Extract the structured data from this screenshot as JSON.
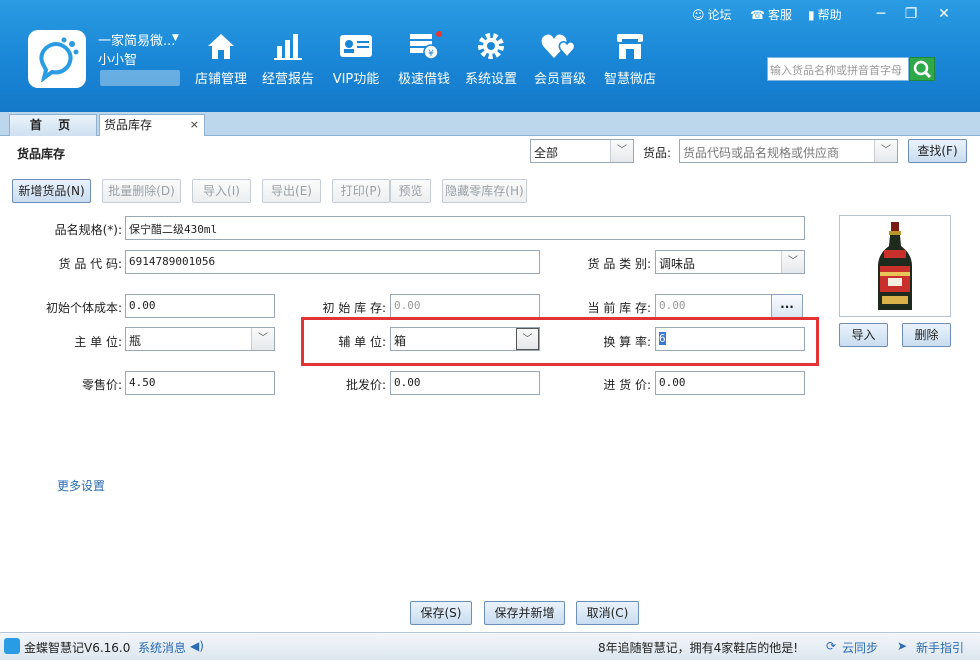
{
  "header": {
    "shop_name": "一家简易微...",
    "user_name": "小小智",
    "nav": [
      "店铺管理",
      "经营报告",
      "VIP功能",
      "极速借钱",
      "系统设置",
      "会员晋级",
      "智慧微店"
    ],
    "top_links": {
      "forum": "论坛",
      "service": "客服",
      "help": "帮助"
    },
    "search_placeholder": "输入货品名称或拼音首字母",
    "accent_color": "#1a86d6"
  },
  "tabs": {
    "home": "首 页",
    "stock": "货品库存",
    "close": "×"
  },
  "page": {
    "title": "货品库存",
    "filter_select": "全部",
    "goods_label": "货品:",
    "goods_placeholder": "货品代码或品名规格或供应商",
    "search_button": "查找(F)"
  },
  "toolbar": {
    "add": "新增货品(N)",
    "batch_delete": "批量删除(D)",
    "import": "导入(I)",
    "export": "导出(E)",
    "print": "打印(P)",
    "preview": "预览",
    "hide_zero": "隐藏零库存(H)"
  },
  "form": {
    "name_label": "品名规格(*):",
    "name_value": "保宁醋二级430ml",
    "code_label": "货 品 代 码:",
    "code_value": "6914789001056",
    "category_label": "货 品 类 别:",
    "category_value": "调味品",
    "init_cost_label": "初始个体成本:",
    "init_cost_value": "0.00",
    "init_stock_label": "初 始 库 存:",
    "init_stock_value": "0.00",
    "current_stock_label": "当 前 库 存:",
    "current_stock_value": "0.00",
    "ellipsis": "...",
    "main_unit_label": "主   单   位:",
    "main_unit_value": "瓶",
    "aux_unit_label": "辅   单   位:",
    "aux_unit_value": "箱",
    "rate_label": "换   算   率:",
    "rate_value": "6",
    "retail_label": "零售价:",
    "retail_value": "4.50",
    "wholesale_label": "批发价:",
    "wholesale_value": "0.00",
    "purchase_label": "进 货 价:",
    "purchase_value": "0.00",
    "img_import": "导入",
    "img_delete": "删除",
    "more_settings": "更多设置"
  },
  "footer": {
    "save": "保存(S)",
    "save_new": "保存并新增",
    "cancel": "取消(C)"
  },
  "status": {
    "version": "金蝶智慧记V6.16.0",
    "sys_msg": "系统消息",
    "promo": "8年追随智慧记，拥有4家鞋店的他是!",
    "cloud_sync": "云同步",
    "guide": "新手指引"
  }
}
